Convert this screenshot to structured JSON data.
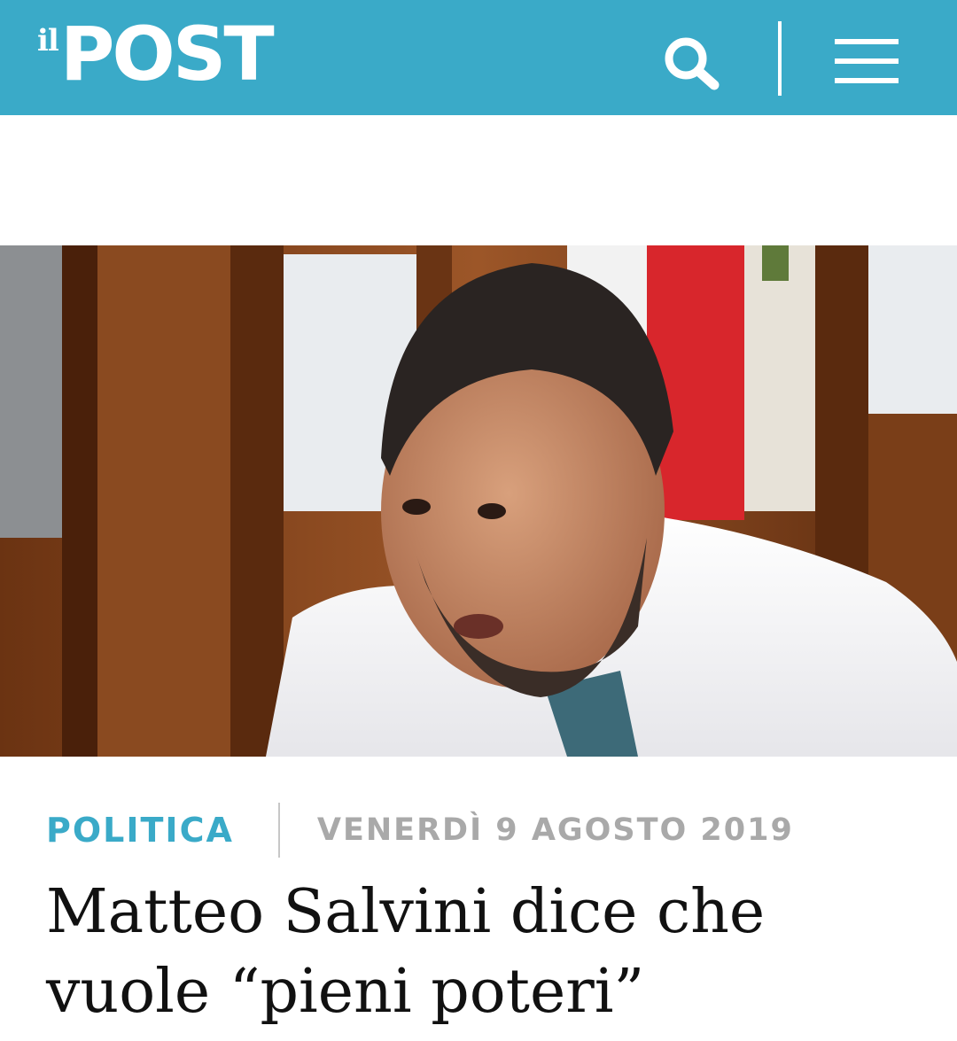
{
  "header": {
    "logo_prefix": "il",
    "logo_main": "POST",
    "search_icon": "search-icon",
    "menu_icon": "hamburger-menu-icon",
    "background_color": "#3aaac8"
  },
  "hero": {
    "image": "article-photo"
  },
  "article": {
    "category": "POLITICA",
    "date": "VENERDÌ 9 AGOSTO 2019",
    "headline_line1": "Matteo Salvini dice che",
    "headline_line2": "vuole “pieni poteri”",
    "accent_color": "#3aaac8",
    "date_color": "#a9a9a9"
  }
}
